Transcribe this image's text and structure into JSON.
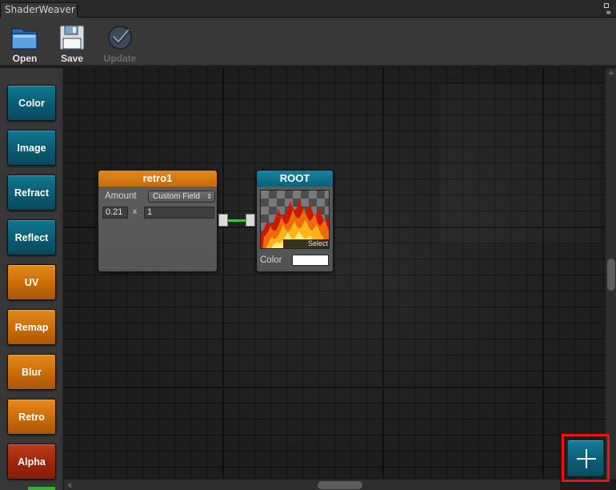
{
  "window": {
    "tab_title": "ShaderWeaver"
  },
  "toolbar": {
    "open_label": "Open",
    "save_label": "Save",
    "update_label": "Update"
  },
  "palette": {
    "buttons": [
      {
        "label": "Color",
        "color": "blue"
      },
      {
        "label": "Image",
        "color": "blue"
      },
      {
        "label": "Refract",
        "color": "blue"
      },
      {
        "label": "Reflect",
        "color": "blue"
      },
      {
        "label": "UV",
        "color": "orange"
      },
      {
        "label": "Remap",
        "color": "orange"
      },
      {
        "label": "Blur",
        "color": "orange"
      },
      {
        "label": "Retro",
        "color": "orange"
      },
      {
        "label": "Alpha",
        "color": "red"
      }
    ]
  },
  "nodes": {
    "retro": {
      "title": "retro1",
      "amount_label": "Amount",
      "amount_mode": "Custom Field",
      "value": "0.21",
      "x_label": "x",
      "factor": "1",
      "header_color": "#d97b10"
    },
    "root": {
      "title": "ROOT",
      "select_label": "Select",
      "color_label": "Color",
      "color_value": "#ffffff",
      "header_color": "#0e7591"
    }
  },
  "colors": {
    "wire": "#38c638",
    "highlight": "#ee1111"
  }
}
